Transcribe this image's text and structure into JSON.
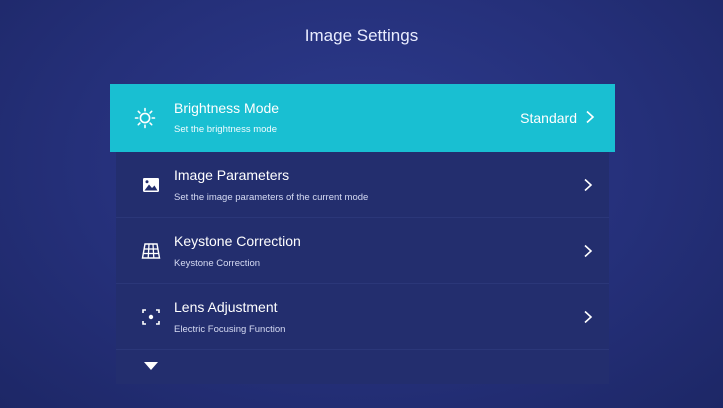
{
  "header": {
    "title": "Image Settings"
  },
  "menu": {
    "items": [
      {
        "icon": "brightness-icon",
        "title": "Brightness Mode",
        "desc": "Set the brightness mode",
        "value": "Standard"
      },
      {
        "icon": "image-icon",
        "title": "Image Parameters",
        "desc": "Set the image parameters of the current mode"
      },
      {
        "icon": "keystone-grid-icon",
        "title": "Keystone Correction",
        "desc": "Keystone Correction"
      },
      {
        "icon": "focus-frame-icon",
        "title": "Lens Adjustment",
        "desc": "Electric Focusing Function"
      },
      {
        "icon": "projection-mode-icon"
      }
    ]
  },
  "colors": {
    "background": "#25307a",
    "item": "#232e6e",
    "active": "#19bfd2"
  }
}
